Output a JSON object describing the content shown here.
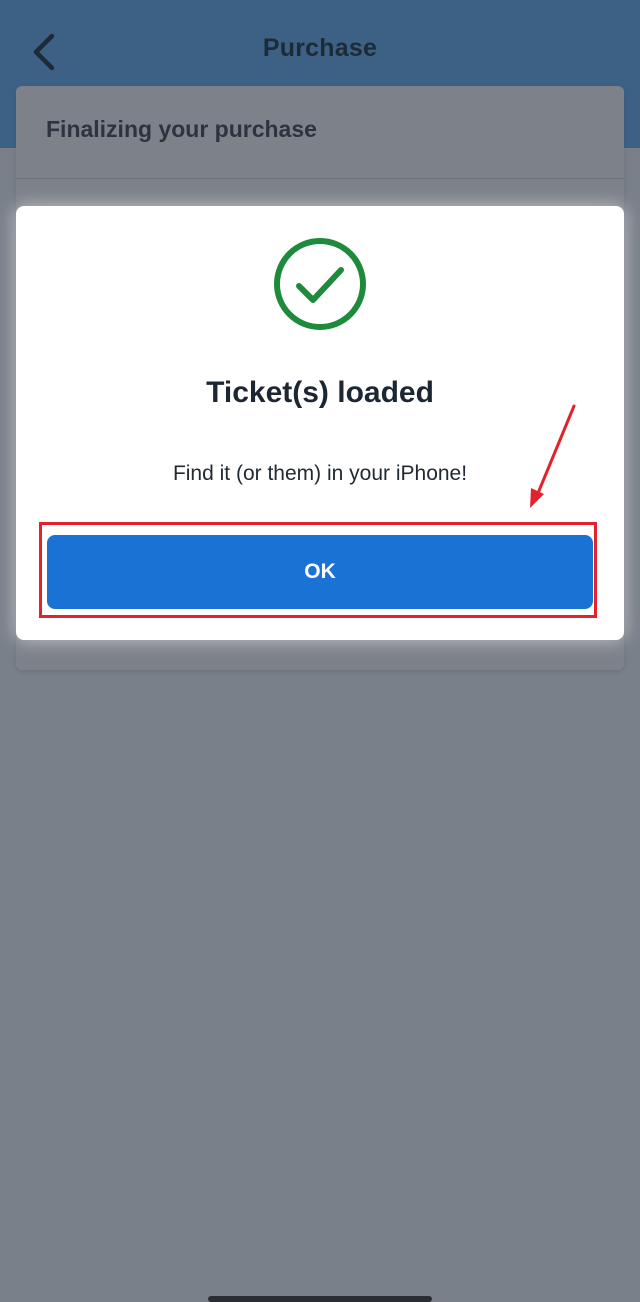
{
  "header": {
    "title": "Purchase",
    "back_icon": "chevron-left-icon"
  },
  "background_card": {
    "title": "Finalizing your purchase"
  },
  "modal": {
    "icon": "check-circle-icon",
    "title": "Ticket(s) loaded",
    "message": "Find it (or them) in your iPhone!",
    "ok_label": "OK"
  },
  "colors": {
    "header_bg": "#3d6185",
    "overlay_bg": "#7a808a",
    "primary_button": "#1a73d4",
    "success_green": "#1e8a3c",
    "annotation_red": "#e3232b"
  }
}
